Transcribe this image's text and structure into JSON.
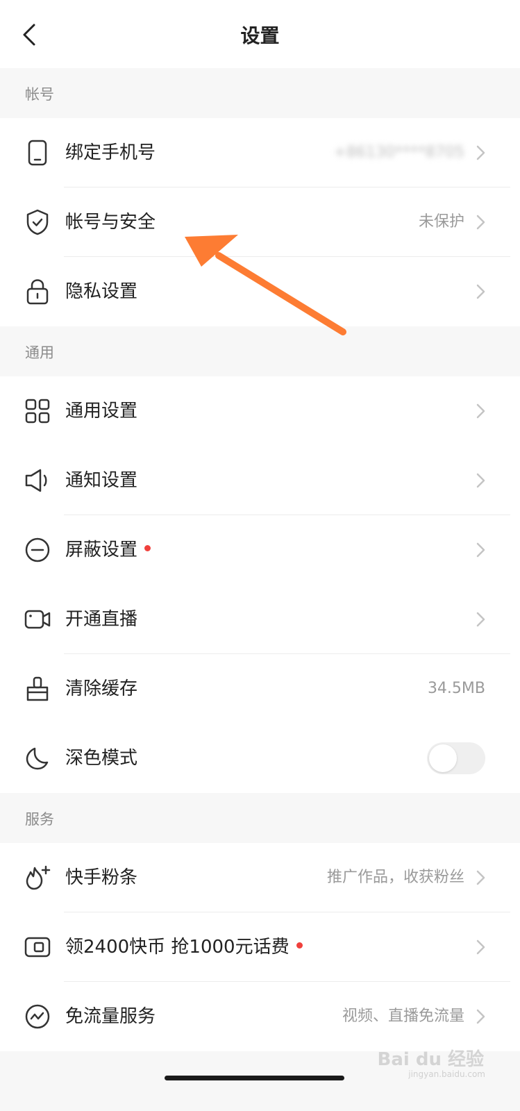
{
  "header": {
    "title": "设置"
  },
  "sections": {
    "account": "帐号",
    "general": "通用",
    "services": "服务"
  },
  "rows": {
    "bind_phone": {
      "label": "绑定手机号",
      "value": "+86130****8705",
      "icon": "phone-icon"
    },
    "account_security": {
      "label": "帐号与安全",
      "value": "未保护",
      "icon": "shield-check-icon"
    },
    "privacy": {
      "label": "隐私设置",
      "icon": "lock-icon"
    },
    "general_settings": {
      "label": "通用设置",
      "icon": "grid-icon"
    },
    "notifications": {
      "label": "通知设置",
      "icon": "speaker-icon"
    },
    "block_settings": {
      "label": "屏蔽设置",
      "icon": "minus-circle-icon",
      "badge": true
    },
    "live": {
      "label": "开通直播",
      "icon": "camera-icon"
    },
    "clear_cache": {
      "label": "清除缓存",
      "value": "34.5MB",
      "icon": "brush-icon"
    },
    "dark_mode": {
      "label": "深色模式",
      "icon": "moon-icon",
      "enabled": false
    },
    "fans_boost": {
      "label": "快手粉条",
      "value": "推广作品，收获粉丝",
      "icon": "flame-plus-icon"
    },
    "coins": {
      "label": "领2400快币 抢1000元话费",
      "icon": "wallet-icon",
      "badge": true
    },
    "free_data": {
      "label": "免流量服务",
      "value": "视频、直播免流量",
      "icon": "pulse-icon"
    }
  },
  "watermark": {
    "main": "Bai du 经验",
    "sub": "jingyan.baidu.com"
  },
  "colors": {
    "accent_arrow": "#fd7c33",
    "badge_red": "#f0403c"
  }
}
